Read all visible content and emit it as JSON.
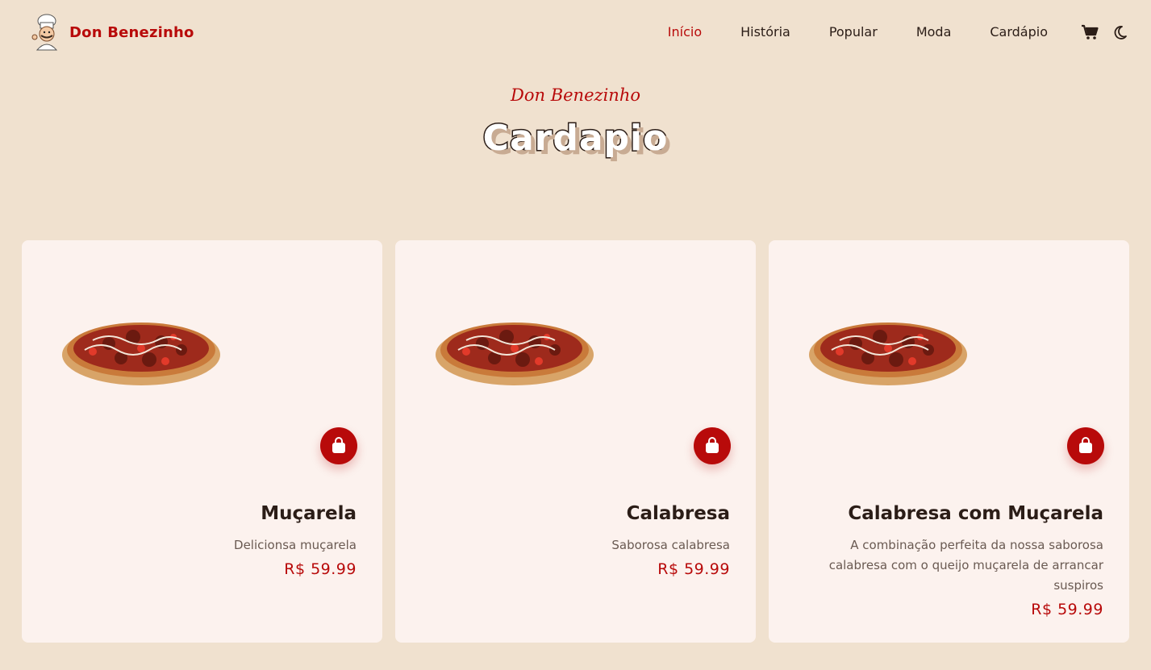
{
  "header": {
    "brand": "Don Benezinho",
    "nav": [
      {
        "label": "Início",
        "active": true
      },
      {
        "label": "História",
        "active": false
      },
      {
        "label": "Popular",
        "active": false
      },
      {
        "label": "Moda",
        "active": false
      },
      {
        "label": "Cardápio",
        "active": false
      }
    ],
    "icons": [
      "cart-icon",
      "moon-icon"
    ]
  },
  "section": {
    "subtitle": "Don Benezinho",
    "title": "Cardapio"
  },
  "products": [
    {
      "name": "Muçarela",
      "description": "Delicionsa muçarela",
      "price": "R$ 59.99"
    },
    {
      "name": "Calabresa",
      "description": "Saborosa calabresa",
      "price": "R$ 59.99"
    },
    {
      "name": "Calabresa com Muçarela",
      "description": "A combinação perfeita da nossa saborosa calabresa com o queijo muçarela de arrancar suspiros",
      "price": "R$ 59.99"
    }
  ],
  "colors": {
    "background": "#f0e1cf",
    "card": "#fcf2ee",
    "accent": "#b80a0a",
    "text": "#2b1d17"
  }
}
